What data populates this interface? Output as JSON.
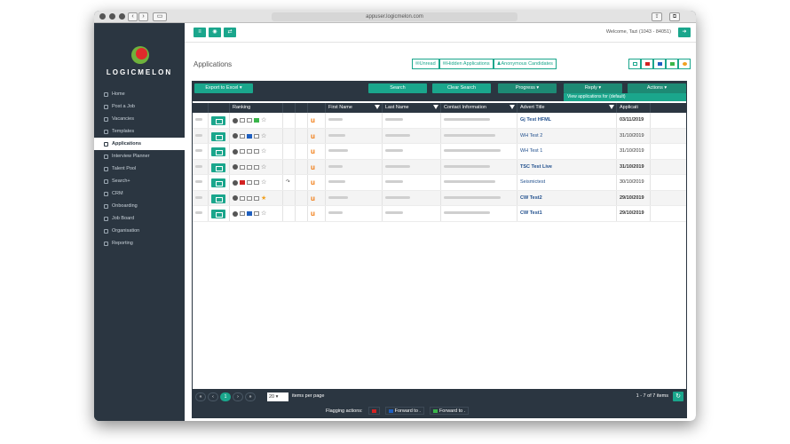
{
  "browser": {
    "url": "appuser.logicmelon.com"
  },
  "logo": {
    "text": "LOGICMELON"
  },
  "sidebar": {
    "items": [
      {
        "label": "Home",
        "icon": "home-icon",
        "active": false
      },
      {
        "label": "Post a Job",
        "icon": "send-icon",
        "active": false
      },
      {
        "label": "Vacancies",
        "icon": "list-icon",
        "active": false
      },
      {
        "label": "Templates",
        "icon": "template-icon",
        "active": false
      },
      {
        "label": "Applications",
        "icon": "mail-icon",
        "active": true
      },
      {
        "label": "Interview Planner",
        "icon": "calendar-icon",
        "active": false
      },
      {
        "label": "Talent Pool",
        "icon": "search-icon",
        "active": false
      },
      {
        "label": "Search+",
        "icon": "search-icon",
        "active": false
      },
      {
        "label": "CRM",
        "icon": "crm-icon",
        "active": false
      },
      {
        "label": "Onboarding",
        "icon": "swap-icon",
        "active": false
      },
      {
        "label": "Job Board",
        "icon": "board-icon",
        "active": false
      },
      {
        "label": "Organisation",
        "icon": "people-icon",
        "active": false
      },
      {
        "label": "Reporting",
        "icon": "chart-icon",
        "active": false
      }
    ]
  },
  "header": {
    "welcome": "Welcome, Tazi (1043 - 84051)"
  },
  "page": {
    "title": "Applications"
  },
  "filters": {
    "unread": "Unread",
    "hidden": "Hidden Applications",
    "anonymous": "Anonymous Candidates"
  },
  "actions": {
    "export": "Export to Excel ▾",
    "search": "Search",
    "clear": "Clear Search",
    "progress": "Progress ▾",
    "reply": "Reply ▾",
    "actions": "Actions ▾",
    "view": "View applications for (default)"
  },
  "columns": [
    "",
    "",
    "Ranking",
    "",
    "",
    "",
    "First Name",
    "Last Name",
    "Contact Information",
    "Advert Title",
    "Applicati"
  ],
  "rows": [
    {
      "advert": "Gj Test HFML",
      "bold": true,
      "date": "03/11/2019",
      "dateBold": true,
      "flag": "green",
      "star": false,
      "arrow": false
    },
    {
      "advert": "WH Test 2",
      "bold": false,
      "date": "31/10/2019",
      "dateBold": false,
      "flag": "blue",
      "star": false,
      "arrow": false
    },
    {
      "advert": "WH Test 1",
      "bold": false,
      "date": "31/10/2019",
      "dateBold": false,
      "flag": "none",
      "star": false,
      "arrow": false
    },
    {
      "advert": "TSC Test Live",
      "bold": true,
      "date": "31/10/2019",
      "dateBold": true,
      "flag": "none",
      "star": false,
      "arrow": false
    },
    {
      "advert": "Seismictest",
      "bold": false,
      "date": "30/10/2019",
      "dateBold": false,
      "flag": "red",
      "star": false,
      "arrow": true
    },
    {
      "advert": "CW Test2",
      "bold": true,
      "date": "29/10/2019",
      "dateBold": true,
      "flag": "none",
      "star": true,
      "arrow": false
    },
    {
      "advert": "CW Test1",
      "bold": true,
      "date": "29/10/2019",
      "dateBold": true,
      "flag": "blue",
      "star": false,
      "arrow": false
    }
  ],
  "pager": {
    "page": "1",
    "size": "20",
    "size_label": "items per page",
    "count": "1 - 7 of 7 items"
  },
  "flagging": {
    "label": "Flagging actions:",
    "forward1": "Forward to .",
    "forward2": "Forward to ."
  },
  "colors": {
    "accent": "#1aa68c",
    "dark": "#2b3641"
  }
}
